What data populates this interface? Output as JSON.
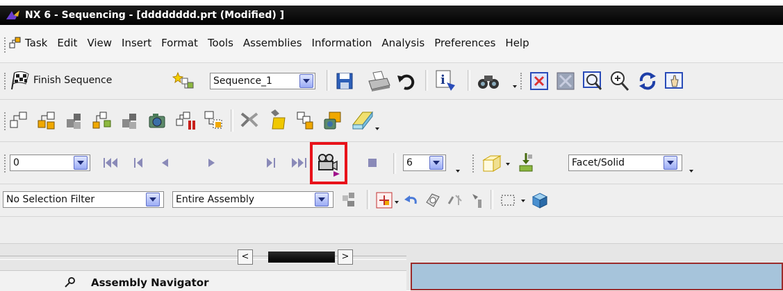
{
  "window": {
    "title": "NX 6 - Sequencing - [dddddddd.prt (Modified) ]"
  },
  "menubar": {
    "items": [
      "Task",
      "Edit",
      "View",
      "Insert",
      "Format",
      "Tools",
      "Assemblies",
      "Information",
      "Analysis",
      "Preferences",
      "Help"
    ]
  },
  "toolbar1": {
    "finish_label": "Finish Sequence",
    "sequence_value": "Sequence_1"
  },
  "playback": {
    "frame_value": "0",
    "step_value": "6",
    "display_value": "Facet/Solid"
  },
  "selection": {
    "filter_value": "No Selection Filter",
    "scope_value": "Entire Assembly"
  },
  "navigator": {
    "title": "Assembly Navigator"
  },
  "colors": {
    "highlight": "#e8121a",
    "titlebar": "#000000",
    "canvas": "#a6c4db"
  },
  "icons": [
    "nx-logo-icon",
    "checkered-flag-icon",
    "new-sequence-icon",
    "save-icon",
    "print-icon",
    "undo-icon",
    "information-icon",
    "binoculars-icon",
    "fit-icon",
    "zoom-icon",
    "rotate-icon",
    "pan-icon",
    "insert-motion-icon",
    "assemble-icon",
    "disassemble-icon",
    "camera-icon",
    "collision-icon",
    "rewind-icon",
    "step-back-icon",
    "play-back-icon",
    "play-forward-icon",
    "step-forward-icon",
    "fast-forward-icon",
    "export-movie-icon",
    "stop-icon",
    "view-triad-icon",
    "undo-arrow-icon",
    "selection-icon",
    "cube-icon"
  ]
}
